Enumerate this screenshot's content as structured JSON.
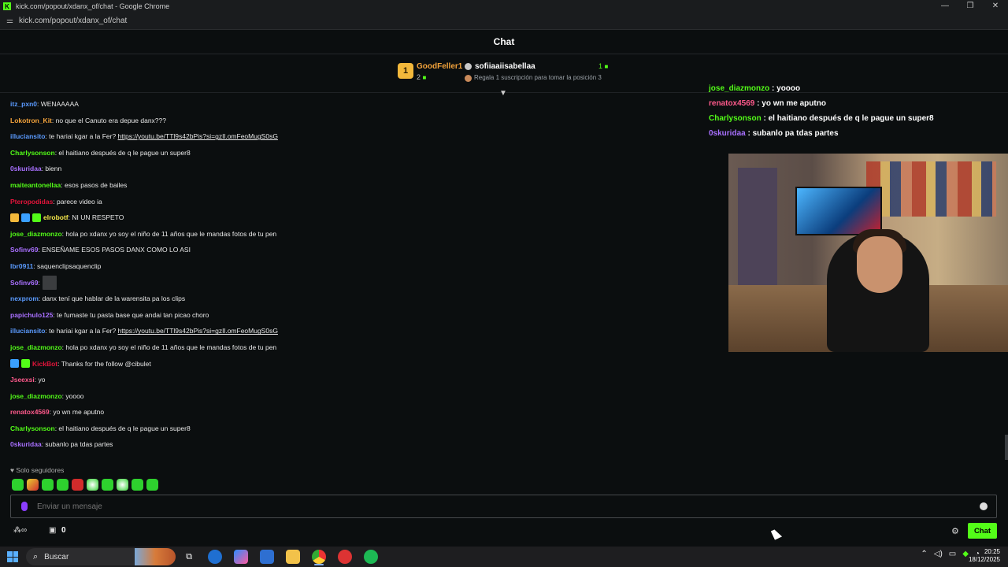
{
  "window": {
    "title": "kick.com/popout/xdanx_of/chat - Google Chrome",
    "url": "kick.com/popout/xdanx_of/chat",
    "controls": [
      "—",
      "❐",
      "✕"
    ]
  },
  "chat_header": {
    "title": "Chat"
  },
  "leaderboard": {
    "rank1": {
      "medal": "1",
      "name": "GoodFeller1",
      "count": "2"
    },
    "rank2": {
      "name": "sofiiaaiisabellaa",
      "count": "1"
    },
    "hint": "Regala 1 suscripción para tomar la posición 3"
  },
  "colors": {
    "accent": "#53fc18",
    "user_green": "#53fc18",
    "user_orange": "#f3a33b",
    "user_purple": "#a970ff",
    "user_blue": "#5b9bff",
    "user_red": "#e1143a",
    "user_pink": "#ff5a8c",
    "user_yellowgreen": "#b6e34b"
  },
  "messages": [
    {
      "user": "itz_pxn0",
      "color": "#5b9bff",
      "text": ": WENAAAAA"
    },
    {
      "user": "Lokotron_Kit",
      "color": "#f3a33b",
      "text": ": no que el Canuto era depue danx???"
    },
    {
      "user": "illuciansito",
      "color": "#5b9bff",
      "text": ": te hariai kgar a la Fer? ",
      "link": "https://youtu.be/TTl9s42bPis?si=gzIl.omFeoMugS0sG"
    },
    {
      "user": "Charlysonson",
      "color": "#53fc18",
      "text": ": el haitiano después de q le pague un super8"
    },
    {
      "user": "0skuridaa",
      "color": "#a970ff",
      "text": ": bienn"
    },
    {
      "user": "maiteantonellaa",
      "color": "#53fc18",
      "text": ": esos pasos de bailes"
    },
    {
      "user": "Pteropodidas",
      "color": "#e1143a",
      "text": ": parece video ia"
    },
    {
      "user": "elrobotf",
      "color": "#f7e94b",
      "text": ": NI UN RESPETO",
      "badges": [
        "#f3b83b",
        "#3aa0ff",
        "#53fc18"
      ]
    },
    {
      "user": "jose_diazmonzo",
      "color": "#53fc18",
      "text": ": hola po xdanx yo soy el niño de 11 años que le mandas fotos de tu pen"
    },
    {
      "user": "Sofinv69",
      "color": "#a970ff",
      "text": ": ENSEÑAME ESOS PASOS DANX COMO LO ASI"
    },
    {
      "user": "lbr0911",
      "color": "#5b9bff",
      "text": ": saquenclipsaquenclip"
    },
    {
      "user": "Sofinv69",
      "color": "#a970ff",
      "text": ":",
      "sticker": true
    },
    {
      "user": "nexprom",
      "color": "#5b9bff",
      "text": ": danx tení que hablar de la warensita pa los clips"
    },
    {
      "user": "papichulo125",
      "color": "#a970ff",
      "text": ": te fumaste tu pasta base que andai tan picao choro"
    },
    {
      "user": "illuciansito",
      "color": "#5b9bff",
      "text": ": te hariai kgar a la Fer? ",
      "link": "https://youtu.be/TTl9s42bPis?si=gzIl.omFeoMugS0sG"
    },
    {
      "user": "jose_diazmonzo",
      "color": "#53fc18",
      "text": ": hola po xdanx yo soy el niño de 11 años que le mandas fotos de tu pen"
    },
    {
      "user": "KickBot",
      "color": "#e1143a",
      "text": ": Thanks for the follow @cibulet",
      "badges": [
        "#3aa0ff",
        "#53fc18"
      ]
    },
    {
      "user": "Jseexsi",
      "color": "#ff5a8c",
      "text": ": yo"
    },
    {
      "user": "jose_diazmonzo",
      "color": "#53fc18",
      "text": ": yoooo"
    },
    {
      "user": "renatox4569",
      "color": "#ff5a8c",
      "text": ": yo wn me aputno"
    },
    {
      "user": "Charlysonson",
      "color": "#53fc18",
      "text": ": el haitiano después de q le pague un super8"
    },
    {
      "user": "0skuridaa",
      "color": "#a970ff",
      "text": ": subanlo pa tdas partes"
    }
  ],
  "overlay": [
    {
      "user": "jose_diazmonzo",
      "color": "#53fc18",
      "text": " : yoooo"
    },
    {
      "user": "renatox4569",
      "color": "#ff5a8c",
      "text": " : yo wn me aputno"
    },
    {
      "user": "Charlysonson",
      "color": "#53fc18",
      "text": " : el haitiano después de q le pague un super8"
    },
    {
      "user": "0skuridaa",
      "color": "#a970ff",
      "text": " : subanlo pa tdas partes"
    }
  ],
  "followers_only": "Solo seguidores",
  "input": {
    "placeholder": "Enviar un mensaje"
  },
  "bottom": {
    "gift_count": "0",
    "chat_button": "Chat"
  },
  "taskbar": {
    "search_placeholder": "Buscar",
    "time": "20:25",
    "date": "18/12/2025"
  }
}
